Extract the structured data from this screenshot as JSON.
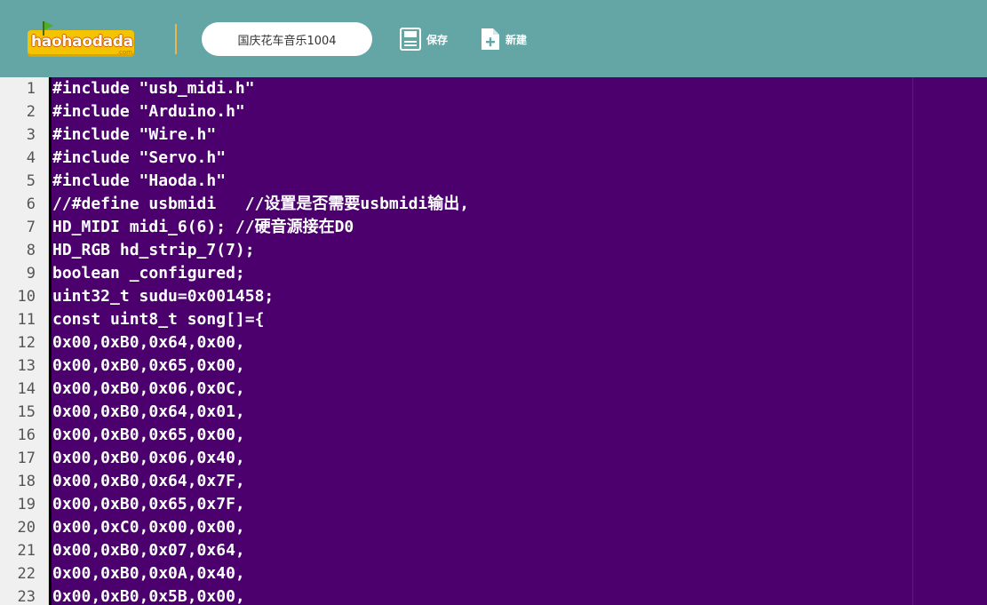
{
  "header": {
    "logo_text": "haohaodada",
    "logo_sub": ".com",
    "file_name": "国庆花车音乐1004",
    "save_label": "保存",
    "new_label": "新建"
  },
  "colors": {
    "topbar": "#64a6a6",
    "editor_bg": "#4b006e",
    "gutter_bg": "#f0f0f0",
    "logo_bg": "#f5c400"
  },
  "icons": {
    "save": "save-icon",
    "new": "new-file-icon",
    "flag": "flag-icon"
  },
  "editor": {
    "lines": [
      {
        "n": "1",
        "text": "#include \"usb_midi.h\""
      },
      {
        "n": "2",
        "text": "#include \"Arduino.h\""
      },
      {
        "n": "3",
        "text": "#include \"Wire.h\""
      },
      {
        "n": "4",
        "text": "#include \"Servo.h\""
      },
      {
        "n": "5",
        "text": "#include \"Haoda.h\""
      },
      {
        "n": "6",
        "text": "//#define usbmidi   //设置是否需要usbmidi输出,"
      },
      {
        "n": "7",
        "text": "HD_MIDI midi_6(6); //硬音源接在D0"
      },
      {
        "n": "8",
        "text": "HD_RGB hd_strip_7(7);"
      },
      {
        "n": "9",
        "text": "boolean _configured;"
      },
      {
        "n": "10",
        "text": "uint32_t sudu=0x001458;"
      },
      {
        "n": "11",
        "text": "const uint8_t song[]={"
      },
      {
        "n": "12",
        "text": "0x00,0xB0,0x64,0x00,"
      },
      {
        "n": "13",
        "text": "0x00,0xB0,0x65,0x00,"
      },
      {
        "n": "14",
        "text": "0x00,0xB0,0x06,0x0C,"
      },
      {
        "n": "15",
        "text": "0x00,0xB0,0x64,0x01,"
      },
      {
        "n": "16",
        "text": "0x00,0xB0,0x65,0x00,"
      },
      {
        "n": "17",
        "text": "0x00,0xB0,0x06,0x40,"
      },
      {
        "n": "18",
        "text": "0x00,0xB0,0x64,0x7F,"
      },
      {
        "n": "19",
        "text": "0x00,0xB0,0x65,0x7F,"
      },
      {
        "n": "20",
        "text": "0x00,0xC0,0x00,0x00,"
      },
      {
        "n": "21",
        "text": "0x00,0xB0,0x07,0x64,"
      },
      {
        "n": "22",
        "text": "0x00,0xB0,0x0A,0x40,"
      },
      {
        "n": "23",
        "text": "0x00,0xB0,0x5B,0x00,"
      }
    ]
  }
}
